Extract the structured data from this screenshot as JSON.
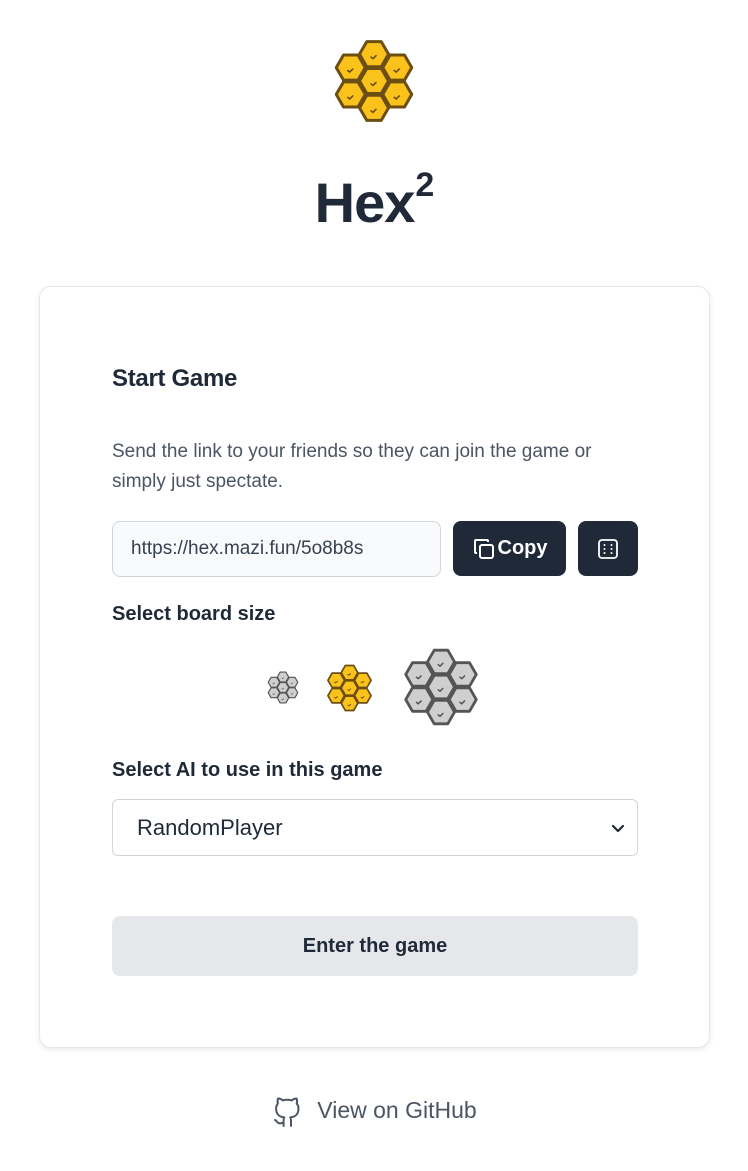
{
  "app": {
    "title": "Hex",
    "title_superscript": "2",
    "logo_icon": "honeycomb-icon"
  },
  "card": {
    "title": "Start Game",
    "description": "Send the link to your friends so they can join the game or simply just spectate.",
    "link_value": "https://hex.mazi.fun/5o8b8s",
    "copy_label": "Copy",
    "copy_icon": "copy-icon",
    "dice_icon": "dice-icon",
    "board_size_label": "Select board size",
    "board_sizes": {
      "options": [
        "small",
        "medium",
        "large"
      ],
      "selected": "medium"
    },
    "ai_label": "Select AI to use in this game",
    "ai_selected": "RandomPlayer",
    "enter_label": "Enter the game"
  },
  "footer": {
    "github_label": "View on GitHub",
    "github_icon": "github-icon"
  },
  "colors": {
    "honey_fill": "#fbc21b",
    "honey_stroke": "#6b4f12",
    "gray_fill": "#cfcfcf",
    "gray_stroke": "#555555",
    "dark_button": "#1f2937",
    "light_button": "#e5e7eb"
  }
}
